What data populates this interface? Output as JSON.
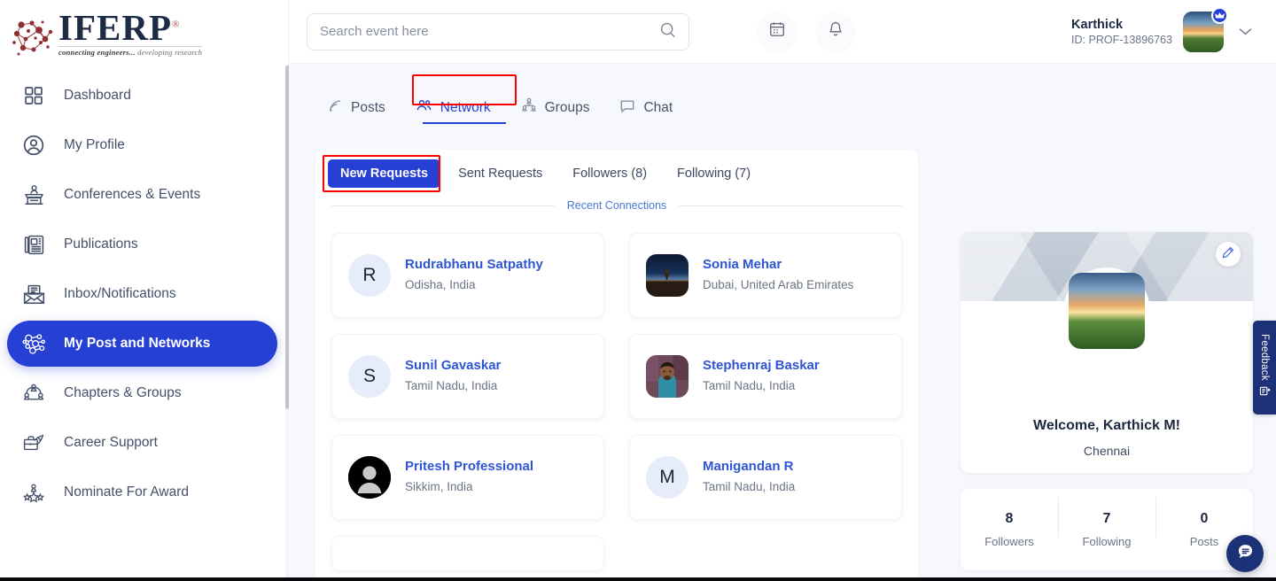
{
  "brand": {
    "name": "IFERP",
    "registered": "®",
    "tagline_1": "connecting engineers...",
    "tagline_2": "developing research"
  },
  "sidebar": {
    "items": [
      {
        "label": "Dashboard",
        "icon": "grid-icon",
        "active": false
      },
      {
        "label": "My Profile",
        "icon": "user-circle-icon",
        "active": false
      },
      {
        "label": "Conferences & Events",
        "icon": "podium-icon",
        "active": false
      },
      {
        "label": "Publications",
        "icon": "newspaper-icon",
        "active": false
      },
      {
        "label": "Inbox/Notifications",
        "icon": "envelope-icon",
        "active": false
      },
      {
        "label": "My Post and Networks",
        "icon": "network-nodes-icon",
        "active": true
      },
      {
        "label": "Chapters & Groups",
        "icon": "people-group-icon",
        "active": false
      },
      {
        "label": "Career Support",
        "icon": "briefcase-icon",
        "active": false
      },
      {
        "label": "Nominate For Award",
        "icon": "award-stars-icon",
        "active": false
      }
    ]
  },
  "topbar": {
    "search": {
      "placeholder": "Search event here",
      "value": "",
      "icon": "search-icon"
    },
    "calendar_icon": "calendar-icon",
    "bell_icon": "bell-icon",
    "user": {
      "name": "Karthick",
      "id": "ID: PROF-13896763",
      "badge_icon": "crown-icon",
      "chevron": "chevron-down-icon"
    }
  },
  "tabs": [
    {
      "label": "Posts",
      "icon": "rss-icon",
      "active": false
    },
    {
      "label": "Network",
      "icon": "people-icon",
      "active": true
    },
    {
      "label": "Groups",
      "icon": "group-tree-icon",
      "active": false
    },
    {
      "label": "Chat",
      "icon": "chat-bubble-icon",
      "active": false
    }
  ],
  "subtabs": [
    {
      "label": "New Requests",
      "active": true
    },
    {
      "label": "Sent Requests",
      "active": false
    },
    {
      "label": "Followers (8)",
      "active": false
    },
    {
      "label": "Following (7)",
      "active": false
    }
  ],
  "section": {
    "divider_label": "Recent Connections"
  },
  "connections": [
    {
      "name": "Rudrabhanu Satpathy",
      "location": "Odisha, India",
      "avatar_type": "initial",
      "initial": "R"
    },
    {
      "name": "Sonia Mehar",
      "location": "Dubai, United Arab Emirates",
      "avatar_type": "photo-night-tree",
      "initial": ""
    },
    {
      "name": "Sunil Gavaskar",
      "location": "Tamil Nadu, India",
      "avatar_type": "initial",
      "initial": "S"
    },
    {
      "name": "Stephenraj Baskar",
      "location": "Tamil Nadu, India",
      "avatar_type": "photo-person",
      "initial": ""
    },
    {
      "name": "Pritesh Professional",
      "location": "Sikkim, India",
      "avatar_type": "silhouette",
      "initial": ""
    },
    {
      "name": "Manigandan R",
      "location": "Tamil Nadu, India",
      "avatar_type": "initial",
      "initial": "M"
    }
  ],
  "profile_card": {
    "welcome": "Welcome, Karthick M!",
    "city": "Chennai",
    "edit_icon": "pencil-icon"
  },
  "stats": [
    {
      "num": "8",
      "label": "Followers"
    },
    {
      "num": "7",
      "label": "Following"
    },
    {
      "num": "0",
      "label": "Posts"
    }
  ],
  "feedback": {
    "label": "Feedback",
    "icon": "feedback-icon"
  },
  "chat_fab": {
    "icon": "chat-icon"
  },
  "colors": {
    "accent_blue": "#2740d4",
    "link_blue": "#2f55d4",
    "highlight_red": "#ff0000",
    "dark_navy": "#1c3177",
    "page_bg": "#f7f8fd"
  }
}
